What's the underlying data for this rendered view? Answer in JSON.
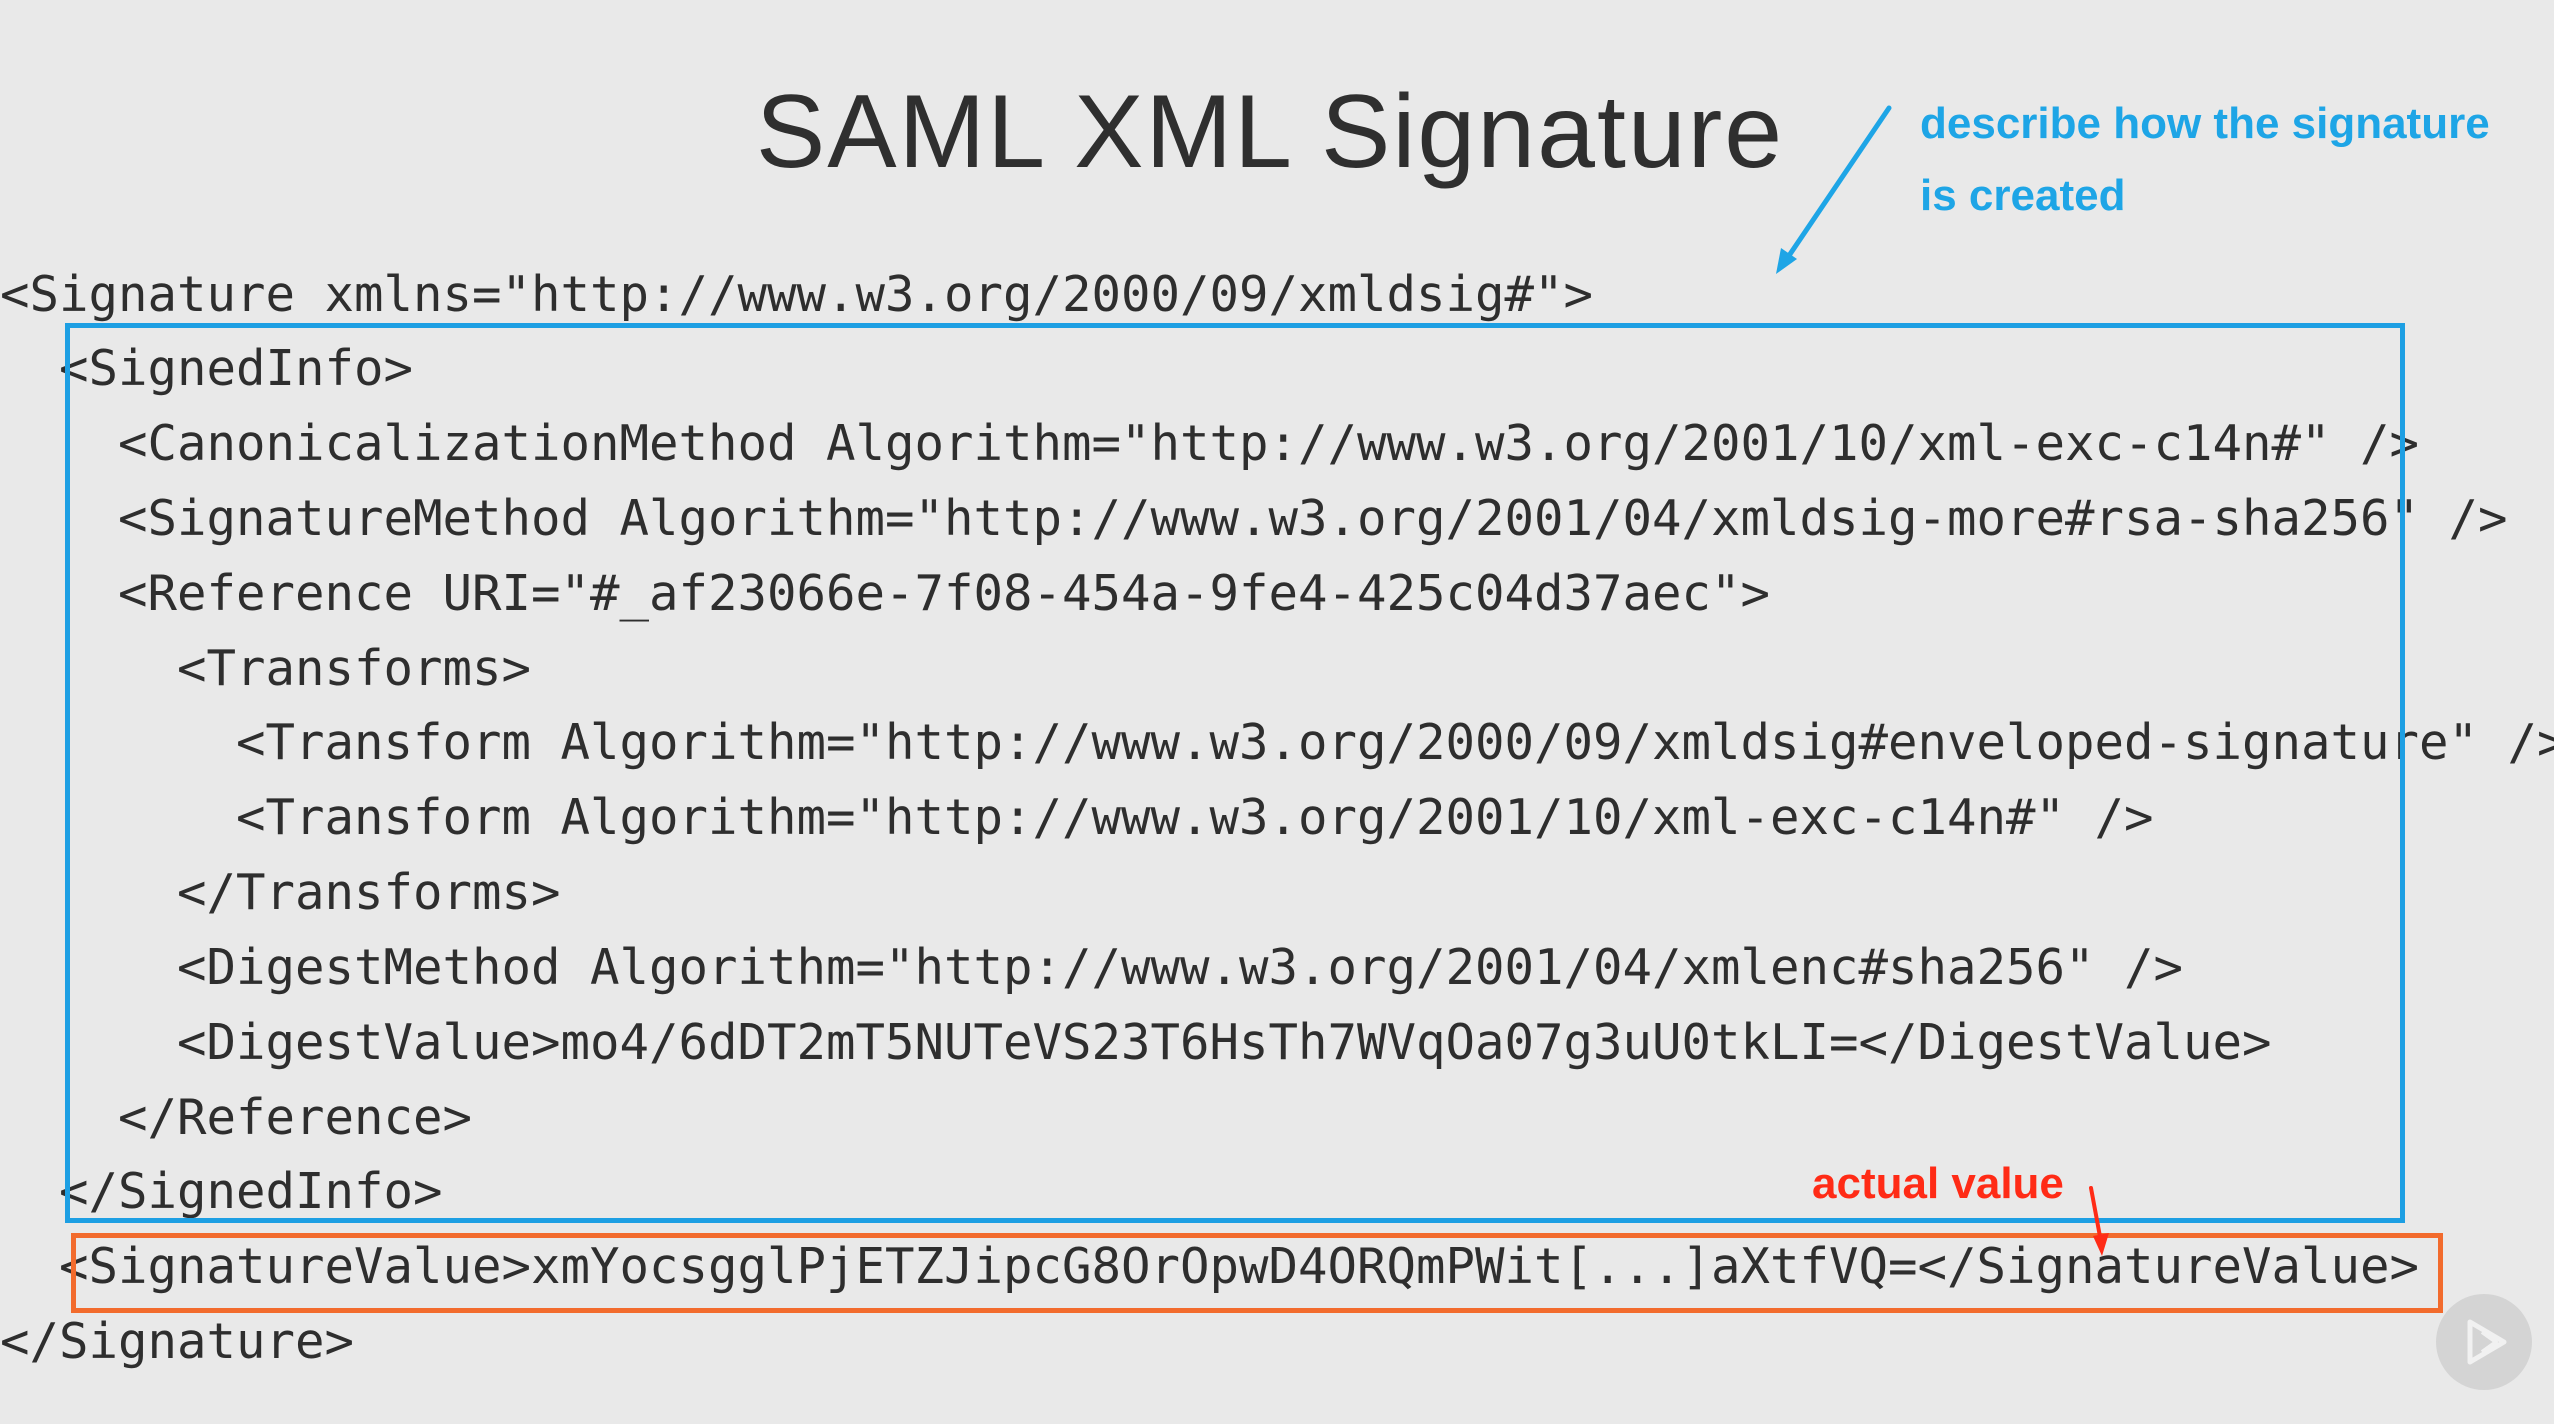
{
  "title": "SAML XML Signature",
  "code_lines": [
    "<Signature xmlns=\"http://www.w3.org/2000/09/xmldsig#\">",
    "  <SignedInfo>",
    "    <CanonicalizationMethod Algorithm=\"http://www.w3.org/2001/10/xml-exc-c14n#\" />",
    "    <SignatureMethod Algorithm=\"http://www.w3.org/2001/04/xmldsig-more#rsa-sha256\" />",
    "    <Reference URI=\"#_af23066e-7f08-454a-9fe4-425c04d37aec\">",
    "      <Transforms>",
    "        <Transform Algorithm=\"http://www.w3.org/2000/09/xmldsig#enveloped-signature\" />",
    "        <Transform Algorithm=\"http://www.w3.org/2001/10/xml-exc-c14n#\" />",
    "      </Transforms>",
    "      <DigestMethod Algorithm=\"http://www.w3.org/2001/04/xmlenc#sha256\" />",
    "      <DigestValue>mo4/6dDT2mT5NUTeVS23T6HsTh7WVqOa07g3uU0tkLI=</DigestValue>",
    "    </Reference>",
    "  </SignedInfo>",
    "  <SignatureValue>xmYocsgglPjETZJipcG8OrOpwD4ORQmPWit[...]aXtfVQ=</SignatureValue>",
    "</Signature>"
  ],
  "annotations": {
    "signed_info_note_line1": "describe how the signature",
    "signed_info_note_line2": "is created",
    "signature_value_note": "actual value"
  },
  "colors": {
    "signed_info_box": "#1d9fe3",
    "signature_value_box": "#f26b2d",
    "blue_note": "#1ea5e6",
    "red_note": "#ff2b16"
  },
  "icons": {
    "watermark": "play-icon"
  }
}
